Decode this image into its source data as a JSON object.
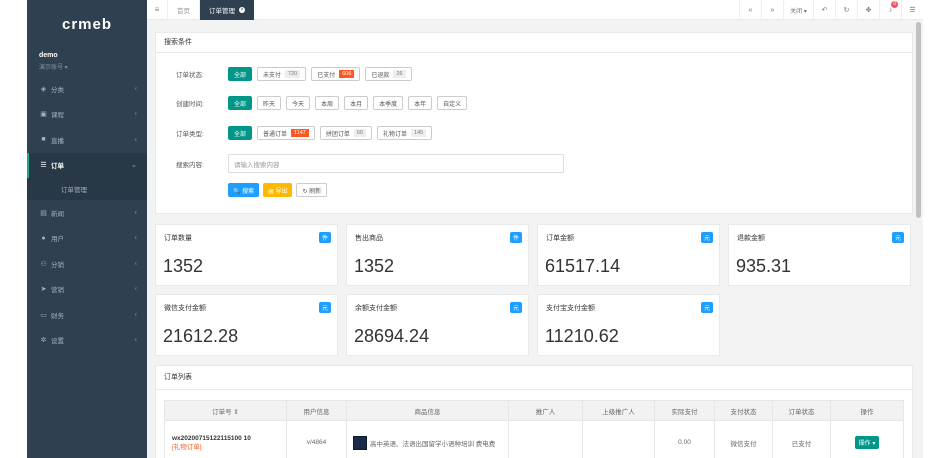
{
  "sidebar": {
    "logo": "crmeb",
    "user_name": "demo",
    "user_role": "演示账号 ▾",
    "items": [
      {
        "label": "分类",
        "icon": "tags-icon"
      },
      {
        "label": "课程",
        "icon": "book-icon"
      },
      {
        "label": "直播",
        "icon": "video-icon"
      },
      {
        "label": "订单",
        "icon": "list-icon"
      },
      {
        "label": "新闻",
        "icon": "news-icon"
      },
      {
        "label": "用户",
        "icon": "user-icon"
      },
      {
        "label": "分销",
        "icon": "share-icon"
      },
      {
        "label": "营销",
        "icon": "send-icon"
      },
      {
        "label": "财务",
        "icon": "money-icon"
      },
      {
        "label": "设置",
        "icon": "gear-icon"
      }
    ],
    "sub_item": "订单管理"
  },
  "topbar": {
    "tabs": [
      "首页",
      "订单管理"
    ],
    "close_label": "关闭 ▾",
    "notify_count": "0"
  },
  "filters": {
    "title": "搜索条件",
    "status": {
      "label": "订单状态:",
      "options": [
        {
          "text": "全部",
          "num": ""
        },
        {
          "text": "未支付",
          "num": "720"
        },
        {
          "text": "已支付",
          "num": "606"
        },
        {
          "text": "已退款",
          "num": "26"
        }
      ]
    },
    "time": {
      "label": "创建时间:",
      "options": [
        "全部",
        "昨天",
        "今天",
        "本周",
        "本月",
        "本季度",
        "本年",
        "自定义"
      ]
    },
    "type": {
      "label": "订单类型:",
      "options": [
        {
          "text": "全部",
          "num": ""
        },
        {
          "text": "普通订单",
          "num": "1147"
        },
        {
          "text": "拼团订单",
          "num": "60"
        },
        {
          "text": "礼物订单",
          "num": "145"
        }
      ]
    },
    "search": {
      "label": "搜索内容:",
      "placeholder": "请输入搜索内容"
    },
    "buttons": {
      "search": "🔍 搜索",
      "export": "▤ 导出",
      "refresh": "↻ 刷新"
    }
  },
  "stats": [
    {
      "title": "订单数量",
      "unit": "件",
      "value": "1352"
    },
    {
      "title": "售出商品",
      "unit": "件",
      "value": "1352"
    },
    {
      "title": "订单金额",
      "unit": "元",
      "value": "61517.14"
    },
    {
      "title": "退款金额",
      "unit": "元",
      "value": "935.31"
    },
    {
      "title": "微信支付金额",
      "unit": "元",
      "value": "21612.28"
    },
    {
      "title": "余额支付金额",
      "unit": "元",
      "value": "28694.24"
    },
    {
      "title": "支付宝支付金额",
      "unit": "元",
      "value": "11210.62"
    }
  ],
  "orders": {
    "title": "订单列表",
    "columns": [
      "订单号 ⇕",
      "用户信息",
      "商品信息",
      "推广人",
      "上级推广人",
      "实际支付",
      "支付状态",
      "订单状态",
      "操作"
    ],
    "rows": [
      {
        "order_no": "wx20200715122115100 10",
        "tag": "[礼物订单]",
        "user": "v/4864",
        "product": "高中英语、法语出国留学小语种培训 费电费",
        "promoter": "",
        "parent": "",
        "paid": "0.00",
        "pay_status": "微信支付",
        "order_status": "已支付",
        "action": "操作 ▾"
      }
    ]
  }
}
